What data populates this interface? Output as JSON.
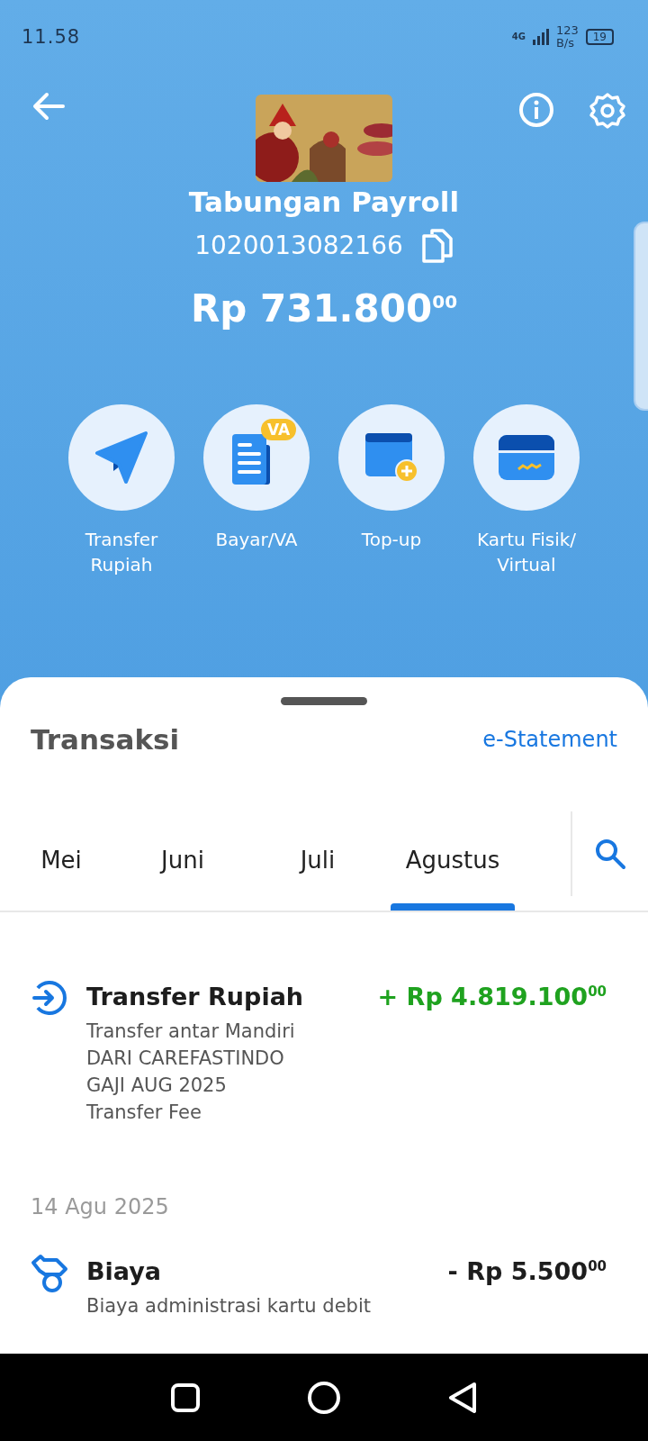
{
  "status_bar": {
    "time": "11.58",
    "network": "4G",
    "speed": "123",
    "speed_unit": "B/s",
    "battery": "19"
  },
  "account": {
    "name": "Tabungan Payroll",
    "number": "1020013082166",
    "balance": "Rp 731.800$^{00}$"
  },
  "actions": [
    {
      "kind": "transfer",
      "lines": [
        "Transfer",
        "Rupiah"
      ]
    },
    {
      "kind": "bill",
      "badge": "VA",
      "lines": [
        "Bayar/VA"
      ]
    },
    {
      "kind": "topup",
      "lines": [
        "Top-up"
      ]
    },
    {
      "kind": "card",
      "lines": [
        "Kartu Fisik/",
        "Virtual"
      ]
    }
  ],
  "transactions_panel": {
    "title": "Transaksi",
    "statement_link": "e-Statement",
    "tabs": [
      {
        "label": "Mei",
        "selected": false
      },
      {
        "label": "Juni",
        "selected": false
      },
      {
        "label": "Juli",
        "selected": false
      },
      {
        "label": "Agustus",
        "selected": true
      }
    ],
    "items": [
      {
        "kind": "transaction",
        "incoming": true,
        "title": "Transfer Rupiah",
        "amount": "+ Rp 4.819.100$^{00}$",
        "details": [
          "Transfer antar Mandiri",
          "DARI CAREFASTINDO",
          "GAJI AUG 2025",
          "Transfer Fee"
        ]
      },
      {
        "kind": "date",
        "label": "14 Agu 2025"
      },
      {
        "kind": "transaction",
        "incoming": false,
        "title": "Biaya",
        "amount": "- Rp 5.500$^{00}$",
        "details": [
          "Biaya administrasi kartu debit"
        ]
      }
    ]
  }
}
